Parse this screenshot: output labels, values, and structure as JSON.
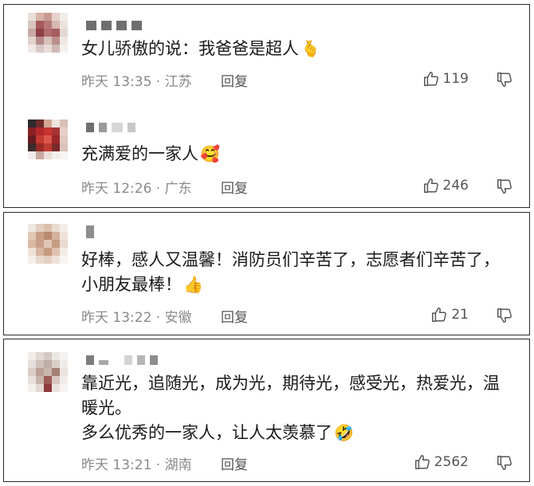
{
  "comments": [
    {
      "text": "女儿骄傲的说：我爸爸是超人",
      "emoji": "🫰",
      "time": "昨天 13:35",
      "location": "江苏",
      "reply_label": "回复",
      "likes": "119",
      "avatar_colors": [
        [
          "#e9e0da",
          "#d7b3a9",
          "#c99b8f",
          "#e4d2cb",
          "#f1ece9"
        ],
        [
          "#d8c5be",
          "#a5595a",
          "#b7787a",
          "#d9b8b2",
          "#ece3df"
        ],
        [
          "#c7a8a2",
          "#8c3f46",
          "#b06c6c",
          "#a75c5e",
          "#e5d7d2"
        ],
        [
          "#e3d3cd",
          "#b68a88",
          "#d6c0ba",
          "#bc8f8c",
          "#efe7e3"
        ],
        [
          "#efe9e6",
          "#d8c9c4",
          "#e6dcd8",
          "#cfb9b4",
          "#f5f1ef"
        ]
      ]
    },
    {
      "text": "充满爱的一家人",
      "emoji": "🥰",
      "time": "昨天 12:26",
      "location": "广东",
      "reply_label": "回复",
      "likes": "246",
      "avatar_colors": [
        [
          "#2e2a2d",
          "#6d2a2b",
          "#d2a796",
          "#efe4df",
          "#d9c1b8"
        ],
        [
          "#8a1f22",
          "#b3272b",
          "#c7342f",
          "#a53334",
          "#e6cfc7"
        ],
        [
          "#661c1f",
          "#c23a31",
          "#d9574a",
          "#9c2628",
          "#e3c8be"
        ],
        [
          "#3b2c2d",
          "#9a2a2a",
          "#c13b32",
          "#7a2a2b",
          "#dac3bb"
        ],
        [
          "#f1ecea",
          "#c9a8a1",
          "#e8dcd7",
          "#f3eeec",
          "#f7f4f2"
        ]
      ]
    },
    {
      "text": "好棒，感人又温馨！消防员们辛苦了，志愿者们辛苦了，小朋友最棒！",
      "emoji": "👍",
      "time": "昨天 13:22",
      "location": "安徽",
      "reply_label": "回复",
      "likes": "21",
      "avatar_colors": [
        [
          "#efe7e0",
          "#e3cfc1",
          "#dcc0ae",
          "#eadbcf",
          "#f4eee9"
        ],
        [
          "#e1c9b6",
          "#c99f84",
          "#b98a70",
          "#d3b29c",
          "#efe3da"
        ],
        [
          "#d9b9a3",
          "#caa08a",
          "#e0c7b5",
          "#c79c83",
          "#ead9cd"
        ],
        [
          "#efe2d8",
          "#d7b59f",
          "#c79b80",
          "#dfc2ae",
          "#f3ebe5"
        ],
        [
          "#f5efea",
          "#e9d9cd",
          "#e4d0c2",
          "#eee2d9",
          "#f8f4f1"
        ]
      ]
    },
    {
      "text": "靠近光，追随光，成为光，期待光，感受光，热爱光，温暖光。\n多么优秀的一家人，让人太羡慕了",
      "emoji": "🤣",
      "time": "昨天 13:21",
      "location": "湖南",
      "reply_label": "回复",
      "likes": "2562",
      "avatar_colors": [
        [
          "#f0ece9",
          "#e0d8d3",
          "#d4c9c2",
          "#ebe5e1",
          "#f5f2f0"
        ],
        [
          "#e6dfdb",
          "#cfc2bb",
          "#bfaea6",
          "#d9cec8",
          "#efebe8"
        ],
        [
          "#dbcdc6",
          "#b99f95",
          "#c9b6ad",
          "#a27e73",
          "#ebe3df"
        ],
        [
          "#e9e1dd",
          "#c9b4ab",
          "#9b5c55",
          "#d7c7c0",
          "#f1ece9"
        ],
        [
          "#f4f0ee",
          "#e3d9d4",
          "#8e3a3c",
          "#e9e1dd",
          "#f7f4f2"
        ]
      ]
    }
  ],
  "colors": {
    "border": "#2b2b2b",
    "meta_text": "#8a8a8a",
    "body_text": "#1a1a1a"
  },
  "icons": [
    "thumbs-up-icon",
    "thumbs-down-icon"
  ]
}
